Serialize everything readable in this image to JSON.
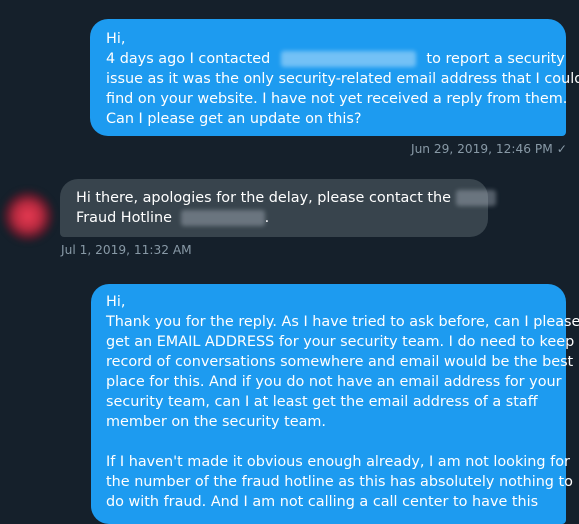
{
  "messages": [
    {
      "lines": [
        "Hi,",
        "4 days ago I contacted",
        "to report a security",
        "issue as it was the only security-related email address that I could",
        "find on your website. I have not yet received a reply from them.",
        "Can I please get an update on this?"
      ],
      "timestamp": "Jun 29, 2019, 12:46 PM",
      "status_icon": "check-icon"
    },
    {
      "lines": [
        "Hi there, apologies for the delay, please contact the",
        "Fraud Hotline",
        "."
      ],
      "timestamp": "Jul 1, 2019, 11:32 AM"
    },
    {
      "lines": [
        "Hi,",
        "Thank you for the reply. As I have tried to ask before, can I please",
        "get an EMAIL ADDRESS for your security team. I do need to keep a",
        "record of conversations somewhere and email would be the best",
        "place for this. And if you do not have an email address for your",
        "security team, can I at least get the email address of a staff",
        "member on the security team.",
        "If I haven't made it obvious enough already, I am not looking for",
        "the number of the fraud hotline as this has absolutely nothing to",
        "do with fraud. And I am not calling a call center to have this"
      ]
    }
  ],
  "colors": {
    "background": "#15202b",
    "outgoing_bubble": "#1d9bf0",
    "incoming_bubble": "#38444d",
    "meta_text": "#8899a6"
  }
}
